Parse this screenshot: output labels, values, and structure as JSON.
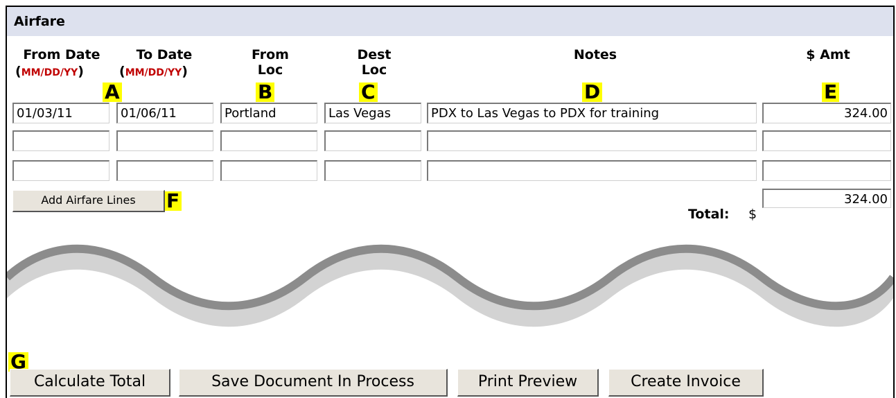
{
  "section": {
    "title": "Airfare"
  },
  "columns": {
    "from_date": "From Date",
    "to_date": "To Date",
    "from_loc_line1": "From",
    "from_loc_line2": "Loc",
    "dest_loc_line1": "Dest",
    "dest_loc_line2": "Loc",
    "notes": "Notes",
    "amount": "$ Amt",
    "date_format": "MM/DD/YY"
  },
  "markers": {
    "a": "A",
    "b": "B",
    "c": "C",
    "d": "D",
    "e": "E",
    "f": "F",
    "g": "G"
  },
  "rows": [
    {
      "from_date": "01/03/11",
      "to_date": "01/06/11",
      "from_loc": "Portland",
      "dest_loc": "Las Vegas",
      "notes": "PDX to Las Vegas to PDX for training",
      "amount": "324.00"
    },
    {
      "from_date": "",
      "to_date": "",
      "from_loc": "",
      "dest_loc": "",
      "notes": "",
      "amount": ""
    },
    {
      "from_date": "",
      "to_date": "",
      "from_loc": "",
      "dest_loc": "",
      "notes": "",
      "amount": ""
    }
  ],
  "add_button": "Add Airfare Lines",
  "total": {
    "label": "Total:",
    "currency": "$",
    "value": "324.00"
  },
  "actions": {
    "calculate": "Calculate Total",
    "save": "Save Document In Process",
    "print": "Print Preview",
    "invoice": "Create Invoice"
  },
  "colors": {
    "header_bg": "#dde1ee",
    "marker": "#ffff00",
    "format_red": "#c00000",
    "button_bg": "#e8e4dc"
  }
}
